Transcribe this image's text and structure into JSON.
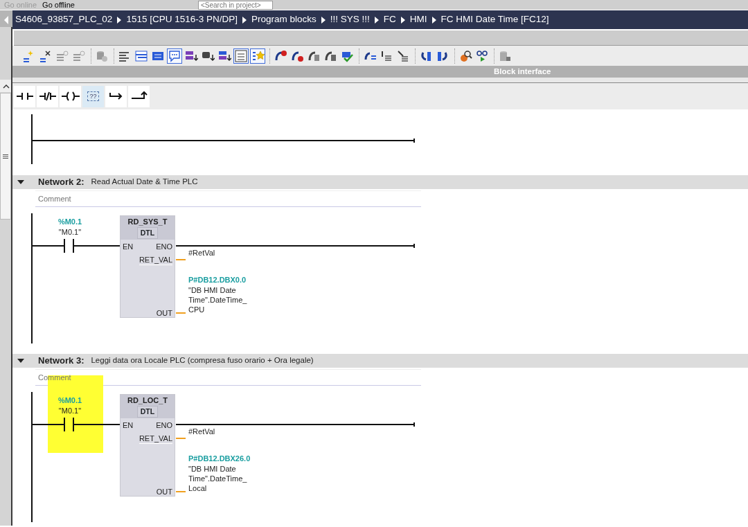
{
  "top_toolbar": {
    "items": [
      {
        "label": "Go online",
        "disabled": true
      },
      {
        "label": "Go offline",
        "disabled": false
      }
    ],
    "search": {
      "placeholder": "<Search in project>"
    }
  },
  "breadcrumb": [
    "S4606_93857_PLC_02",
    "1515 [CPU 1516-3 PN/DP]",
    "Program blocks",
    "!!! SYS !!!",
    "FC",
    "HMI",
    "FC HMI Date Time [FC12]"
  ],
  "editor_toolbar": [
    [
      {
        "selected": false
      },
      {
        "selected": false
      },
      {
        "selected": false
      },
      {
        "selected": false
      }
    ],
    [
      {
        "selected": false
      }
    ],
    [
      {
        "selected": false
      },
      {
        "selected": false
      },
      {
        "selected": false
      },
      {
        "selected": true
      },
      {
        "selected": false
      },
      {
        "selected": false
      },
      {
        "selected": false
      },
      {
        "selected": true
      },
      {
        "selected": true
      }
    ],
    [
      {
        "selected": false
      },
      {
        "selected": false
      },
      {
        "selected": false
      },
      {
        "selected": false
      },
      {
        "selected": false
      }
    ],
    [
      {
        "selected": false
      },
      {
        "selected": false
      },
      {
        "selected": false
      }
    ],
    [
      {
        "selected": false
      },
      {
        "selected": false
      }
    ],
    [
      {
        "selected": false
      },
      {
        "selected": false
      }
    ],
    [
      {
        "selected": false
      }
    ]
  ],
  "panel_title": "Block interface",
  "palette": [
    {
      "kind": "no-contact",
      "selected": false
    },
    {
      "kind": "nc-contact",
      "selected": false
    },
    {
      "kind": "coil",
      "selected": false
    },
    {
      "kind": "empty-box",
      "label": "??",
      "selected": true
    },
    {
      "kind": "branch-open",
      "selected": false
    },
    {
      "kind": "branch-close",
      "selected": false
    }
  ],
  "networks": [
    {
      "kind": "stub"
    },
    {
      "kind": "full",
      "label": "Network 2:",
      "title": "Read Actual Date & Time PLC",
      "expanded": true,
      "comment": {
        "placeholder": "Comment"
      },
      "contact": {
        "address": "%M0.1",
        "tag": "\"M0.1\"",
        "highlighted": false
      },
      "block": {
        "name": "RD_SYS_T",
        "type": "DTL",
        "inputs": [
          "EN"
        ],
        "outputs": [
          "ENO",
          "RET_VAL",
          "OUT"
        ]
      },
      "ret_val": "#RetVal",
      "out": {
        "address": "P#DB12.DBX0.0",
        "lines": [
          "\"DB HMI Date",
          "Time\".DateTime_",
          "CPU"
        ]
      }
    },
    {
      "kind": "full",
      "label": "Network 3:",
      "title": "Leggi data ora Locale PLC (compresa fuso orario + Ora legale)",
      "expanded": true,
      "comment": {
        "placeholder": "Comment"
      },
      "contact": {
        "address": "%M0.1",
        "tag": "\"M0.1\"",
        "highlighted": true
      },
      "block": {
        "name": "RD_LOC_T",
        "type": "DTL",
        "inputs": [
          "EN"
        ],
        "outputs": [
          "ENO",
          "RET_VAL",
          "OUT"
        ]
      },
      "ret_val": "#RetVal",
      "out": {
        "address": "P#DB12.DBX26.0",
        "lines": [
          "\"DB HMI Date",
          "Time\".DateTime_",
          "Local"
        ]
      }
    }
  ]
}
